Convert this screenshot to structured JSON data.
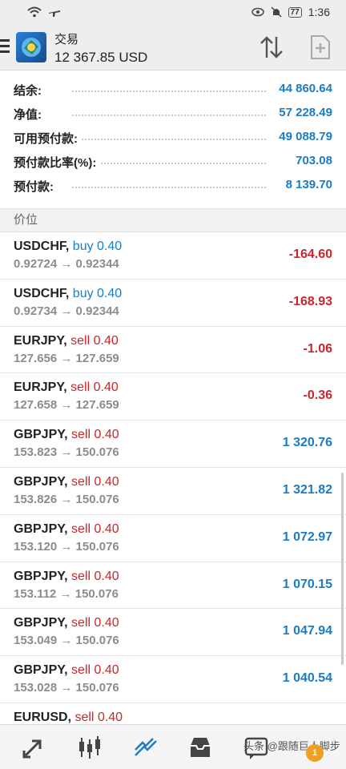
{
  "status_bar": {
    "time": "1:36",
    "battery": "77"
  },
  "header": {
    "title": "交易",
    "balance": "12 367.85 USD"
  },
  "summary": [
    {
      "label": "结余:",
      "value": "44 860.64"
    },
    {
      "label": "净值:",
      "value": "57 228.49"
    },
    {
      "label": "可用预付款:",
      "value": "49 088.79"
    },
    {
      "label": "预付款比率(%):",
      "value": "703.08"
    },
    {
      "label": "预付款:",
      "value": "8 139.70"
    }
  ],
  "section_title": "价位",
  "positions": [
    {
      "symbol": "USDCHF,",
      "side": "buy",
      "volume": "0.40",
      "prices": "0.92724 → 0.92344",
      "profit": "-164.60"
    },
    {
      "symbol": "USDCHF,",
      "side": "buy",
      "volume": "0.40",
      "prices": "0.92734 → 0.92344",
      "profit": "-168.93"
    },
    {
      "symbol": "EURJPY,",
      "side": "sell",
      "volume": "0.40",
      "prices": "127.656 → 127.659",
      "profit": "-1.06"
    },
    {
      "symbol": "EURJPY,",
      "side": "sell",
      "volume": "0.40",
      "prices": "127.658 → 127.659",
      "profit": "-0.36"
    },
    {
      "symbol": "GBPJPY,",
      "side": "sell",
      "volume": "0.40",
      "prices": "153.823 → 150.076",
      "profit": "1 320.76"
    },
    {
      "symbol": "GBPJPY,",
      "side": "sell",
      "volume": "0.40",
      "prices": "153.826 → 150.076",
      "profit": "1 321.82"
    },
    {
      "symbol": "GBPJPY,",
      "side": "sell",
      "volume": "0.40",
      "prices": "153.120 → 150.076",
      "profit": "1 072.97"
    },
    {
      "symbol": "GBPJPY,",
      "side": "sell",
      "volume": "0.40",
      "prices": "153.112 → 150.076",
      "profit": "1 070.15"
    },
    {
      "symbol": "GBPJPY,",
      "side": "sell",
      "volume": "0.40",
      "prices": "153.049 → 150.076",
      "profit": "1 047.94"
    },
    {
      "symbol": "GBPJPY,",
      "side": "sell",
      "volume": "0.40",
      "prices": "153.028 → 150.076",
      "profit": "1 040.54"
    },
    {
      "symbol": "EURUSD,",
      "side": "sell",
      "volume": "0.40",
      "prices": "",
      "profit": ""
    }
  ],
  "bottom_nav": {
    "items": [
      {
        "icon": "quotes-icon"
      },
      {
        "icon": "chart-icon"
      },
      {
        "icon": "trade-icon",
        "active": true
      },
      {
        "icon": "history-icon"
      },
      {
        "icon": "messages-icon"
      }
    ],
    "watermark": "头条 @跟随巨人脚步",
    "badge": "1"
  },
  "colors": {
    "blue": "#1b7bc4",
    "red": "#c9262b",
    "muted": "#8c8c8c"
  }
}
